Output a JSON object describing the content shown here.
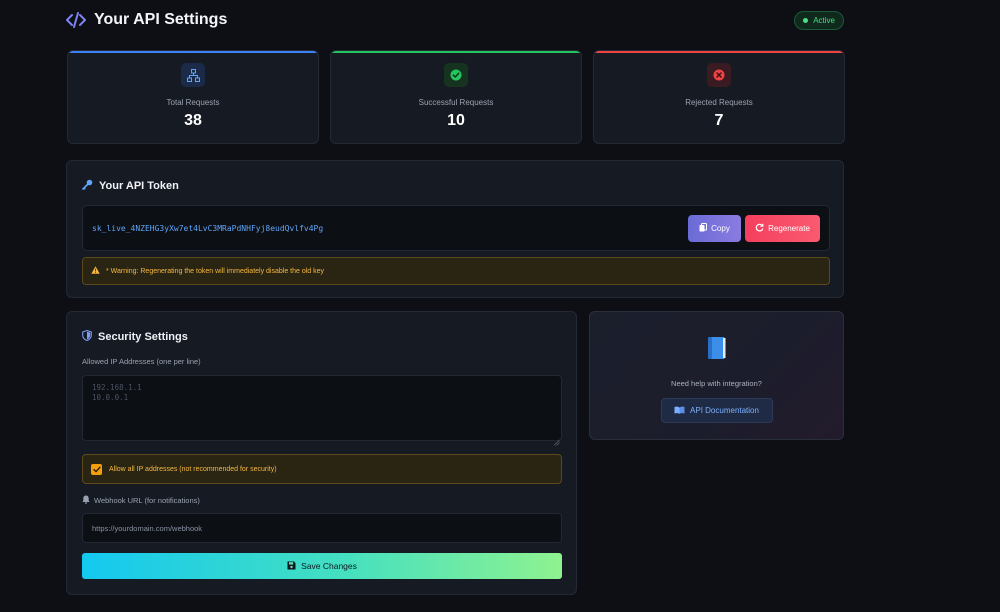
{
  "header": {
    "title": "Your API Settings",
    "status": "Active",
    "icon": "code-icon"
  },
  "stats": [
    {
      "label": "Total Requests",
      "value": "38",
      "icon": "network-icon",
      "accent": "#3b82f6"
    },
    {
      "label": "Successful Requests",
      "value": "10",
      "icon": "check-circle-icon",
      "accent": "#22c55e"
    },
    {
      "label": "Rejected Requests",
      "value": "7",
      "icon": "x-circle-icon",
      "accent": "#ef4444"
    }
  ],
  "token": {
    "title": "Your API Token",
    "value": "sk_live_4NZEHG3yXw7et4LvC3MRaPdNHFyj8eudQvlfv4Pg",
    "copy_label": "Copy",
    "regenerate_label": "Regenerate",
    "warning": "* Warning: Regenerating the token will immediately disable the old key"
  },
  "security": {
    "title": "Security Settings",
    "ip_label": "Allowed IP Addresses (one per line)",
    "ip_placeholder": "192.168.1.1\n10.0.0.1",
    "allow_all_label": "Allow all IP addresses (not recommended for security)",
    "allow_all_checked": true,
    "webhook_label": "Webhook URL (for notifications)",
    "webhook_placeholder": "https://yourdomain.com/webhook",
    "save_label": "Save Changes"
  },
  "help": {
    "text": "Need help with integration?",
    "docs_label": "API Documentation"
  },
  "colors": {
    "background": "#0d0f14",
    "panel": "#161a22",
    "accent_blue": "#3b82f6",
    "accent_green": "#22c55e",
    "accent_red": "#ef4444",
    "warning": "#f5b942"
  }
}
